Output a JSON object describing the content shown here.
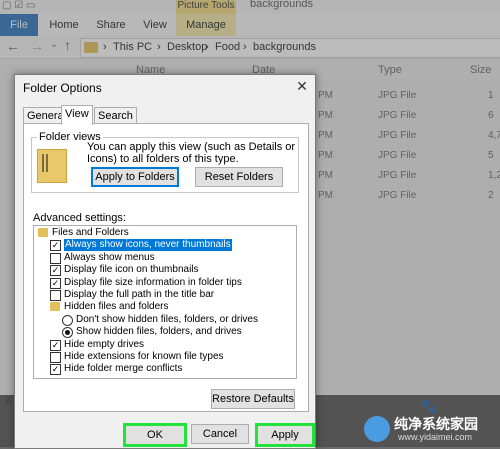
{
  "explorer": {
    "ribbon_context_label": "Picture Tools",
    "window_title": "backgrounds",
    "tabs": [
      "File",
      "Home",
      "Share",
      "View",
      "Manage"
    ],
    "breadcrumb": [
      "This PC",
      "Desktop",
      "Food",
      "backgrounds"
    ],
    "columns": [
      "Name",
      "Date",
      "Type",
      "Size"
    ],
    "rows": [
      {
        "date": "PM",
        "type": "JPG File",
        "size": "1"
      },
      {
        "date": "PM",
        "type": "JPG File",
        "size": "6"
      },
      {
        "date": "PM",
        "type": "JPG File",
        "size": "4,7"
      },
      {
        "date": "PM",
        "type": "JPG File",
        "size": "5"
      },
      {
        "date": "PM",
        "type": "JPG File",
        "size": "1,2"
      },
      {
        "date": "PM",
        "type": "JPG File",
        "size": "2"
      }
    ],
    "item_count": "6"
  },
  "dialog": {
    "title": "Folder Options",
    "tabs": [
      "General",
      "View",
      "Search"
    ],
    "active_tab": "View",
    "folder_views": {
      "group_label": "Folder views",
      "description": "You can apply this view (such as Details or Icons) to all folders of this type.",
      "apply_button": "Apply to Folders",
      "reset_button": "Reset Folders"
    },
    "advanced_label": "Advanced settings:",
    "settings": [
      {
        "kind": "folder",
        "label": "Files and Folders",
        "indent": 0
      },
      {
        "kind": "checkbox",
        "label": "Always show icons, never thumbnails",
        "checked": true,
        "selected": true,
        "indent": 1
      },
      {
        "kind": "checkbox",
        "label": "Always show menus",
        "checked": false,
        "indent": 1
      },
      {
        "kind": "checkbox",
        "label": "Display file icon on thumbnails",
        "checked": true,
        "indent": 1
      },
      {
        "kind": "checkbox",
        "label": "Display file size information in folder tips",
        "checked": true,
        "indent": 1
      },
      {
        "kind": "checkbox",
        "label": "Display the full path in the title bar",
        "checked": false,
        "indent": 1
      },
      {
        "kind": "folder",
        "label": "Hidden files and folders",
        "indent": 1
      },
      {
        "kind": "radio",
        "label": "Don't show hidden files, folders, or drives",
        "checked": false,
        "indent": 2
      },
      {
        "kind": "radio",
        "label": "Show hidden files, folders, and drives",
        "checked": true,
        "indent": 2
      },
      {
        "kind": "checkbox",
        "label": "Hide empty drives",
        "checked": true,
        "indent": 1
      },
      {
        "kind": "checkbox",
        "label": "Hide extensions for known file types",
        "checked": false,
        "indent": 1
      },
      {
        "kind": "checkbox",
        "label": "Hide folder merge conflicts",
        "checked": true,
        "indent": 1
      }
    ],
    "restore_button": "Restore Defaults",
    "ok_button": "OK",
    "cancel_button": "Cancel",
    "apply_button": "Apply",
    "highlight_color": "#23e23a"
  },
  "watermark": {
    "text": "纯净系统家园",
    "url": "www.yidaimei.com"
  }
}
